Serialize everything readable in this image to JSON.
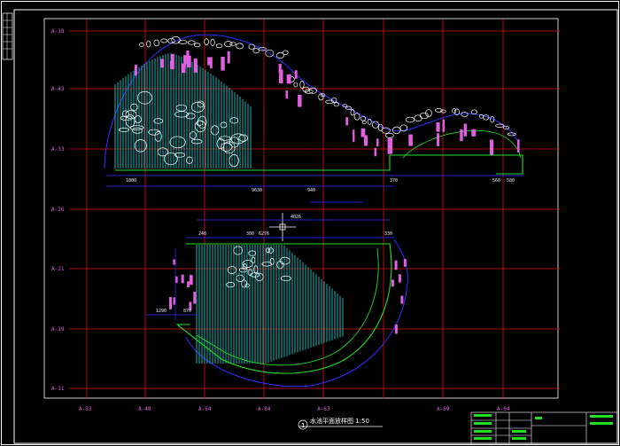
{
  "drawing": {
    "title": "水池平面放样图 1:50",
    "title_number": "1"
  },
  "grid": {
    "row_labels": [
      "A-18",
      "A-43",
      "A-33",
      "A-26",
      "A-21",
      "A-19",
      "A-11"
    ],
    "col_labels": [
      "A-33",
      "A-48",
      "A-54",
      "A-84",
      "A-63",
      "A-69",
      "A-04"
    ]
  },
  "dimensions": {
    "top": [
      "1800",
      "9630",
      "370",
      "560",
      "580"
    ],
    "bottom": [
      "6276",
      "240",
      "330",
      "300",
      "1290",
      "870"
    ],
    "center": [
      "940",
      "4026"
    ]
  },
  "colors": {
    "background": "#000000",
    "frame": "#ffffff",
    "grid_line": "#e01010",
    "dim_line": "#3030ff",
    "label": "#e060e0",
    "pool_edge": "#20e020",
    "hatch": "#20c8c8",
    "rock": "#ffffff"
  }
}
